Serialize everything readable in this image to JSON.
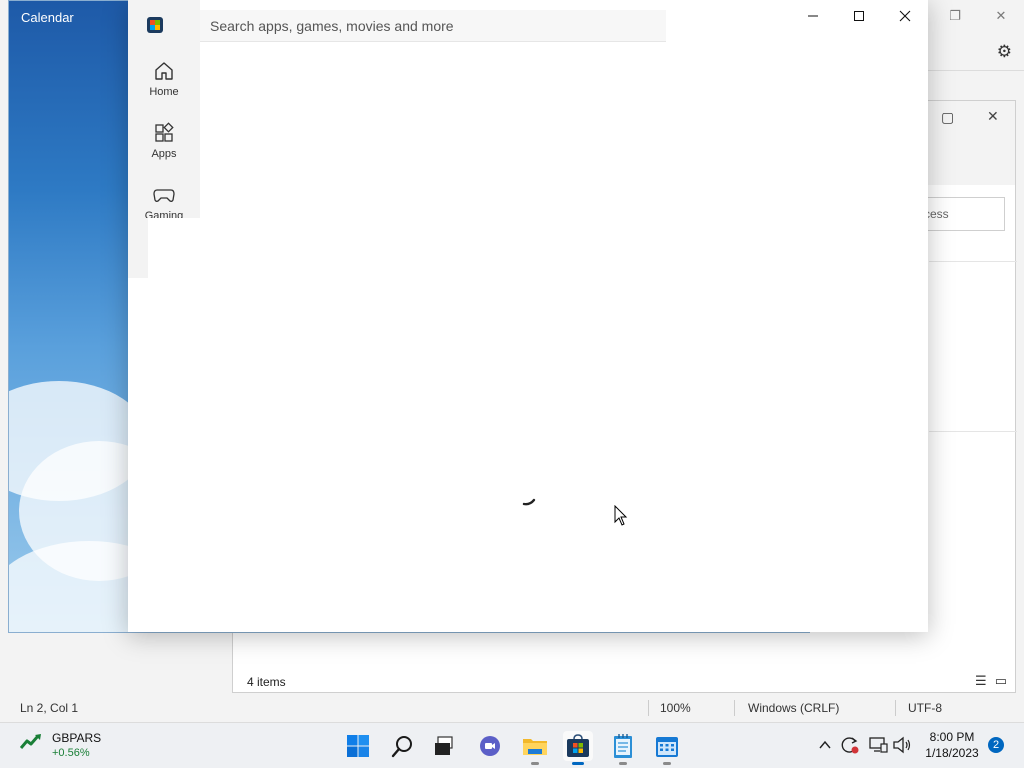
{
  "notepad": {
    "status": {
      "position": "Ln 2, Col 1",
      "zoom": "100%",
      "line_ending": "Windows (CRLF)",
      "encoding": "UTF-8"
    }
  },
  "explorer": {
    "search_placeholder": "cess",
    "item_count": "4 items"
  },
  "calendar": {
    "title": "Calendar"
  },
  "store": {
    "search_placeholder": "Search apps, games, movies and more",
    "nav": [
      {
        "label": "Home",
        "icon": "home-icon"
      },
      {
        "label": "Apps",
        "icon": "apps-icon"
      },
      {
        "label": "Gaming",
        "icon": "gamepad-icon"
      }
    ]
  },
  "taskbar": {
    "widget": {
      "symbol": "GBPARS",
      "change": "+0.56%"
    },
    "apps": [
      {
        "name": "start",
        "icon": "windows-logo-icon"
      },
      {
        "name": "search",
        "icon": "search-icon"
      },
      {
        "name": "task-view",
        "icon": "task-view-icon"
      },
      {
        "name": "chat",
        "icon": "chat-icon"
      },
      {
        "name": "file-explorer",
        "icon": "folder-icon"
      },
      {
        "name": "store",
        "icon": "store-icon"
      },
      {
        "name": "notepad",
        "icon": "notepad-icon"
      },
      {
        "name": "calendar",
        "icon": "calendar-icon"
      }
    ],
    "time": "8:00 PM",
    "date": "1/18/2023",
    "notifications": "2"
  },
  "colors": {
    "accent": "#0067c0",
    "stock_up": "#1a7f37"
  }
}
